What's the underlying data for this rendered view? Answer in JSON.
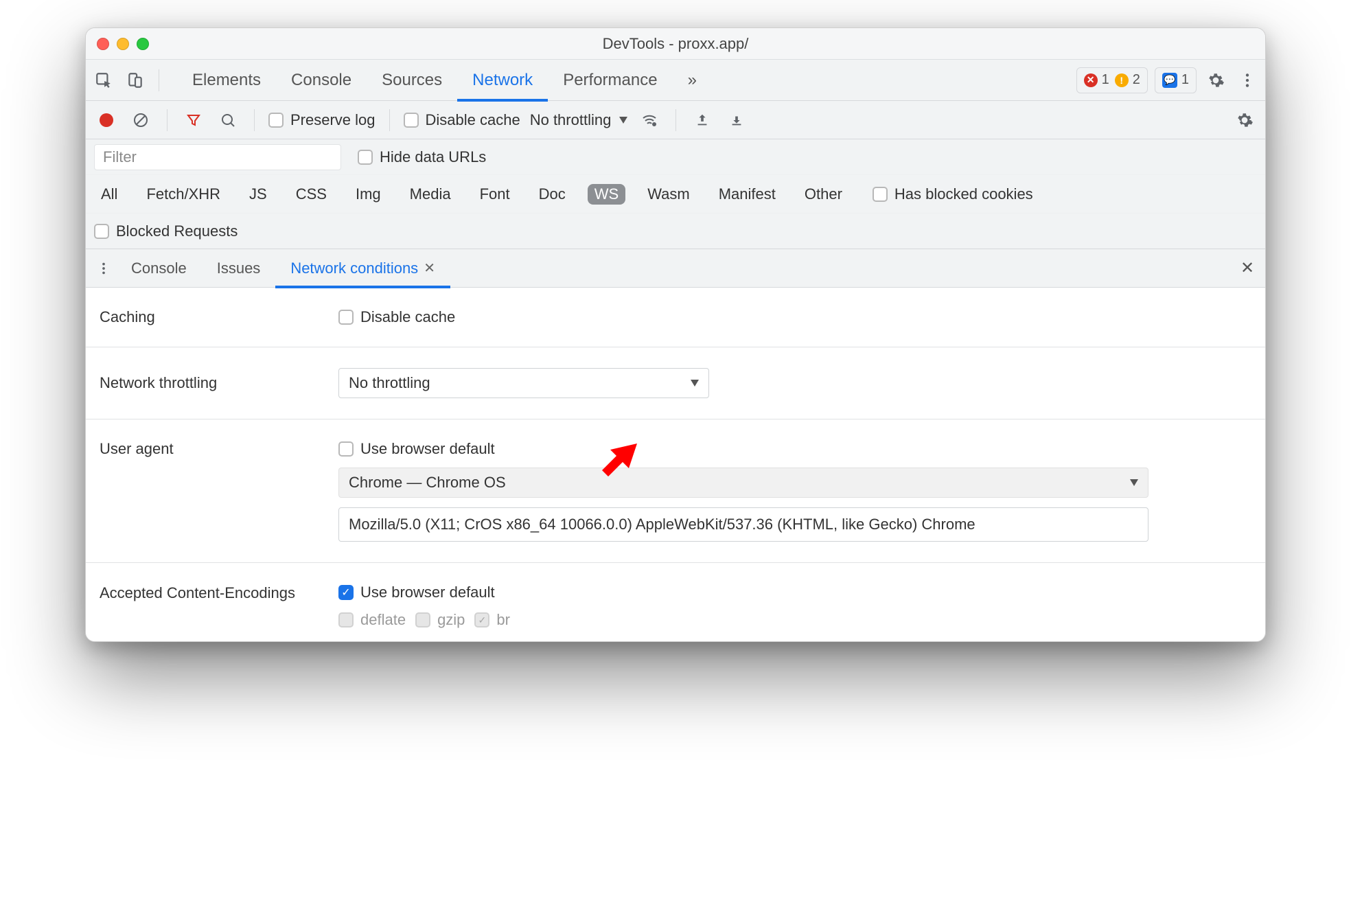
{
  "window": {
    "title": "DevTools - proxx.app/"
  },
  "tabs": {
    "elements": "Elements",
    "console": "Console",
    "sources": "Sources",
    "network": "Network",
    "performance": "Performance",
    "moreGlyph": "»"
  },
  "counters": {
    "errors": "1",
    "warnings": "2",
    "comments": "1"
  },
  "networkToolbar": {
    "preserveLog": "Preserve log",
    "disableCache": "Disable cache",
    "throttlingLabel": "No throttling"
  },
  "filterRow": {
    "placeholder": "Filter",
    "hideDataUrls": "Hide data URLs"
  },
  "types": {
    "all": "All",
    "fetch": "Fetch/XHR",
    "js": "JS",
    "css": "CSS",
    "img": "Img",
    "media": "Media",
    "font": "Font",
    "doc": "Doc",
    "ws": "WS",
    "wasm": "Wasm",
    "manifest": "Manifest",
    "other": "Other",
    "hasBlocked": "Has blocked cookies"
  },
  "blockedRow": {
    "blockedRequests": "Blocked Requests"
  },
  "drawer": {
    "console": "Console",
    "issues": "Issues",
    "netcond": "Network conditions"
  },
  "netcond": {
    "cachingLabel": "Caching",
    "cachingDisable": "Disable cache",
    "throttlingLabel": "Network throttling",
    "throttlingValue": "No throttling",
    "uaLabel": "User agent",
    "uaUseDefault": "Use browser default",
    "uaSelection": "Chrome — Chrome OS",
    "uaString": "Mozilla/5.0 (X11; CrOS x86_64 10066.0.0) AppleWebKit/537.36 (KHTML, like Gecko) Chrome",
    "encLabel": "Accepted Content-Encodings",
    "encUseDefault": "Use browser default",
    "encDeflate": "deflate",
    "encGzip": "gzip",
    "encBr": "br"
  }
}
